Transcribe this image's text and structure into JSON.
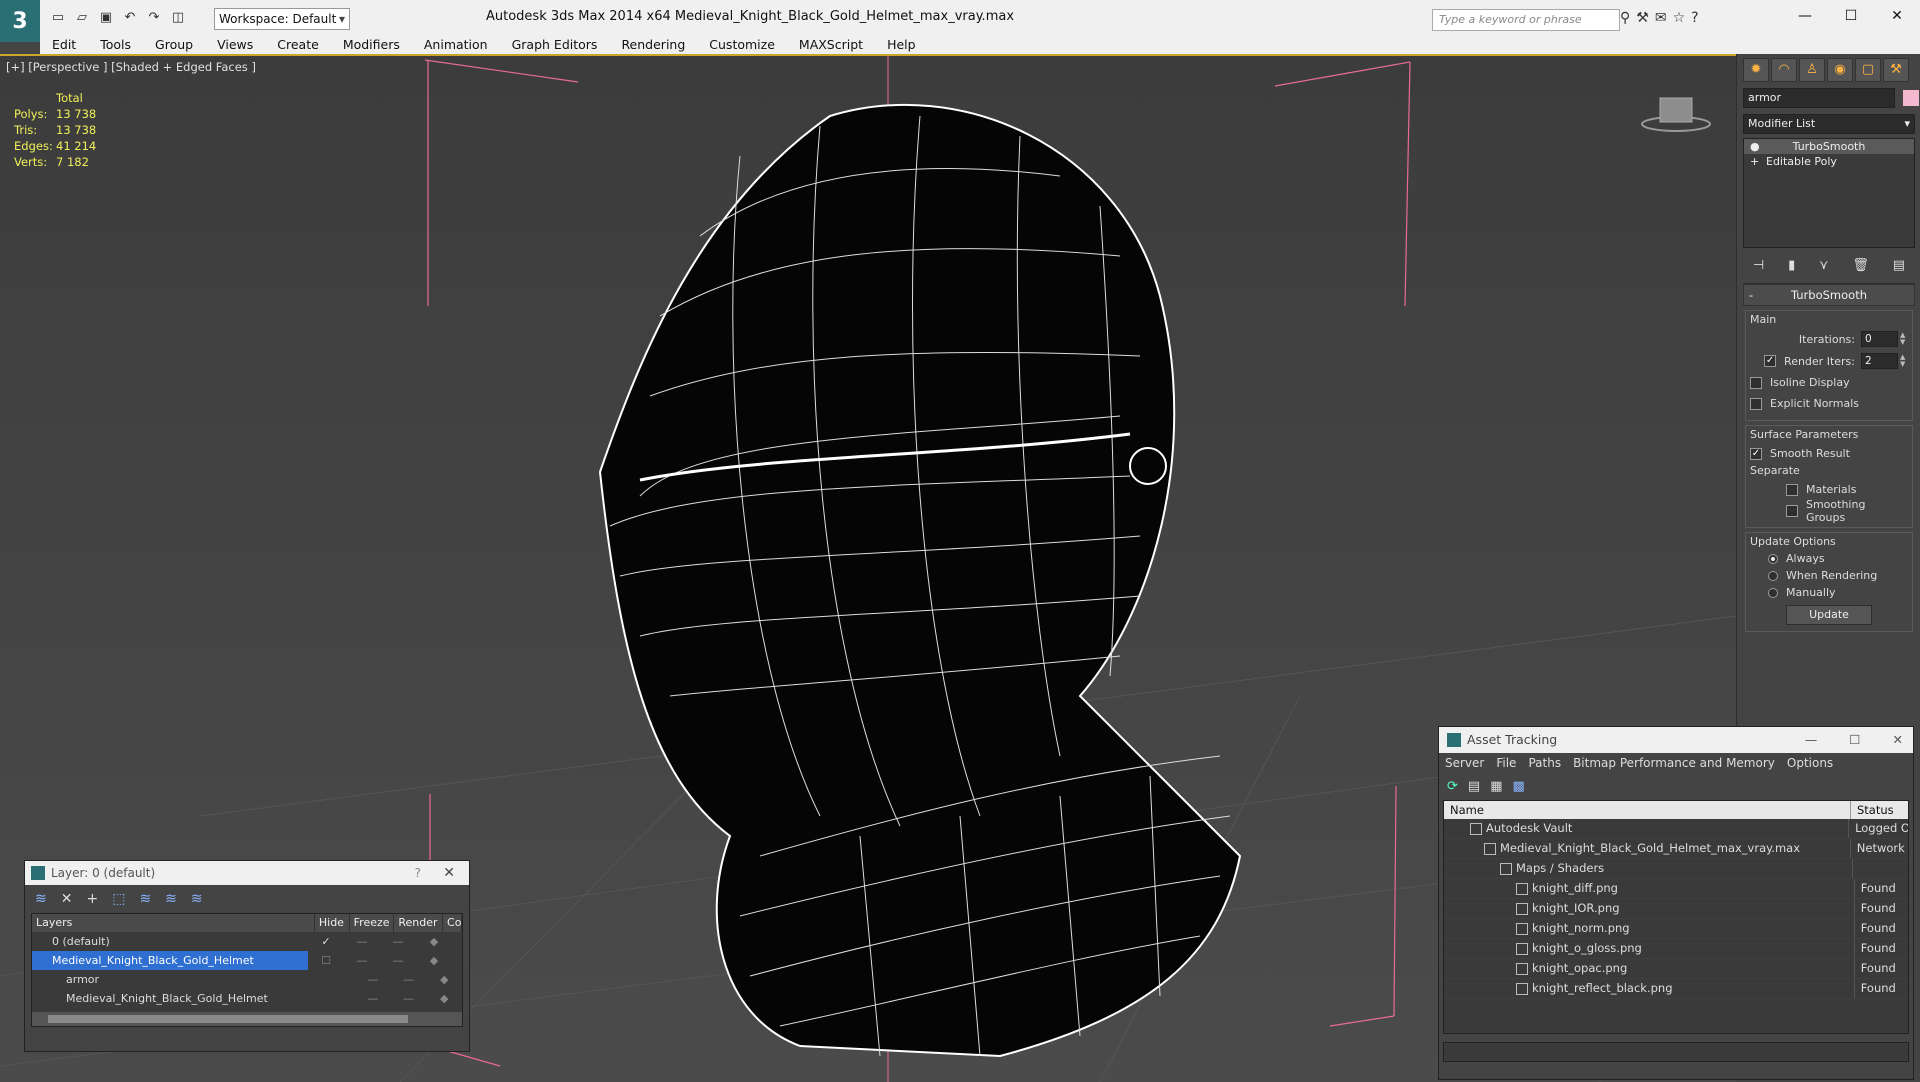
{
  "app": {
    "title": "Autodesk 3ds Max  2014 x64      Medieval_Knight_Black_Gold_Helmet_max_vray.max",
    "workspace": "Workspace: Default",
    "search_placeholder": "Type a keyword or phrase"
  },
  "menu": [
    "Edit",
    "Tools",
    "Group",
    "Views",
    "Create",
    "Modifiers",
    "Animation",
    "Graph Editors",
    "Rendering",
    "Customize",
    "MAXScript",
    "Help"
  ],
  "viewport": {
    "label": "[+] [Perspective ] [Shaded + Edged Faces ]",
    "stats": {
      "header": "Total",
      "rows": [
        {
          "k": "Polys:",
          "v": "13 738"
        },
        {
          "k": "Tris:",
          "v": "13 738"
        },
        {
          "k": "Edges:",
          "v": "41 214"
        },
        {
          "k": "Verts:",
          "v": "7 182"
        }
      ]
    }
  },
  "command_panel": {
    "object_name": "armor",
    "object_color": "#f4b8cf",
    "modifier_list": "Modifier List",
    "stack": [
      "TurboSmooth",
      "Editable Poly"
    ],
    "rollout": {
      "title": "TurboSmooth",
      "main": "Main",
      "iterations_label": "Iterations:",
      "iterations": "0",
      "render_iters_label": "Render Iters:",
      "render_iters": "2",
      "isoline": "Isoline Display",
      "explicit_normals": "Explicit Normals",
      "surface_params": "Surface Parameters",
      "smooth_result": "Smooth Result",
      "separate": "Separate",
      "materials": "Materials",
      "smoothing_groups": "Smoothing Groups",
      "update_options": "Update Options",
      "always": "Always",
      "when_rendering": "When Rendering",
      "manually": "Manually",
      "update": "Update"
    }
  },
  "layer_window": {
    "title": "Layer: 0 (default)",
    "help": "?",
    "columns": [
      "Layers",
      "Hide",
      "Freeze",
      "Render",
      "Co"
    ],
    "rows": [
      {
        "name": "0 (default)",
        "active": "✓"
      },
      {
        "name": "Medieval_Knight_Black_Gold_Helmet"
      },
      {
        "name": "armor"
      },
      {
        "name": "Medieval_Knight_Black_Gold_Helmet"
      }
    ]
  },
  "asset_window": {
    "title": "Asset Tracking",
    "menu": [
      "Server",
      "File",
      "Paths",
      "Bitmap Performance and Memory",
      "Options"
    ],
    "columns": [
      "Name",
      "Status"
    ],
    "rows": [
      {
        "name": "Autodesk Vault",
        "status": "Logged O"
      },
      {
        "name": "Medieval_Knight_Black_Gold_Helmet_max_vray.max",
        "status": "Network F"
      },
      {
        "name": "Maps / Shaders",
        "status": ""
      },
      {
        "name": "knight_diff.png",
        "status": "Found"
      },
      {
        "name": "knight_IOR.png",
        "status": "Found"
      },
      {
        "name": "knight_norm.png",
        "status": "Found"
      },
      {
        "name": "knight_o_gloss.png",
        "status": "Found"
      },
      {
        "name": "knight_opac.png",
        "status": "Found"
      },
      {
        "name": "knight_reflect_black.png",
        "status": "Found"
      }
    ]
  }
}
